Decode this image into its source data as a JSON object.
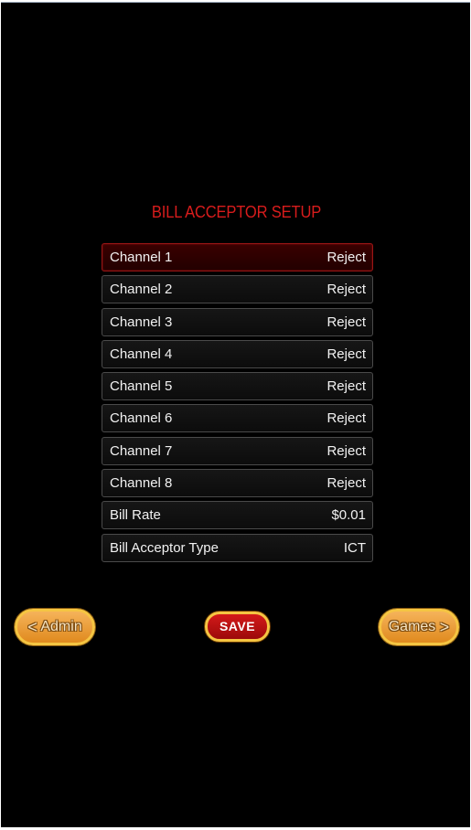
{
  "screen": {
    "title": "BILL ACCEPTOR SETUP"
  },
  "settings": [
    {
      "label": "Channel 1",
      "value": "Reject",
      "selected": true
    },
    {
      "label": "Channel 2",
      "value": "Reject"
    },
    {
      "label": "Channel 3",
      "value": "Reject"
    },
    {
      "label": "Channel 4",
      "value": "Reject"
    },
    {
      "label": "Channel 5",
      "value": "Reject"
    },
    {
      "label": "Channel 6",
      "value": "Reject"
    },
    {
      "label": "Channel 7",
      "value": "Reject"
    },
    {
      "label": "Channel 8",
      "value": "Reject"
    },
    {
      "label": "Bill Rate",
      "value": "$0.01"
    },
    {
      "label": "Bill Acceptor Type",
      "value": "ICT"
    }
  ],
  "buttons": {
    "admin_label": "Admin",
    "admin_chevron": "<",
    "save_label": "SAVE",
    "games_label": "Games",
    "games_chevron": ">"
  },
  "colors": {
    "background": "#000000",
    "title": "#d81c1c",
    "selected_row": "#3a0000",
    "button_orange": "#f0a040",
    "button_red": "#c01010",
    "button_border": "#f5c542"
  }
}
